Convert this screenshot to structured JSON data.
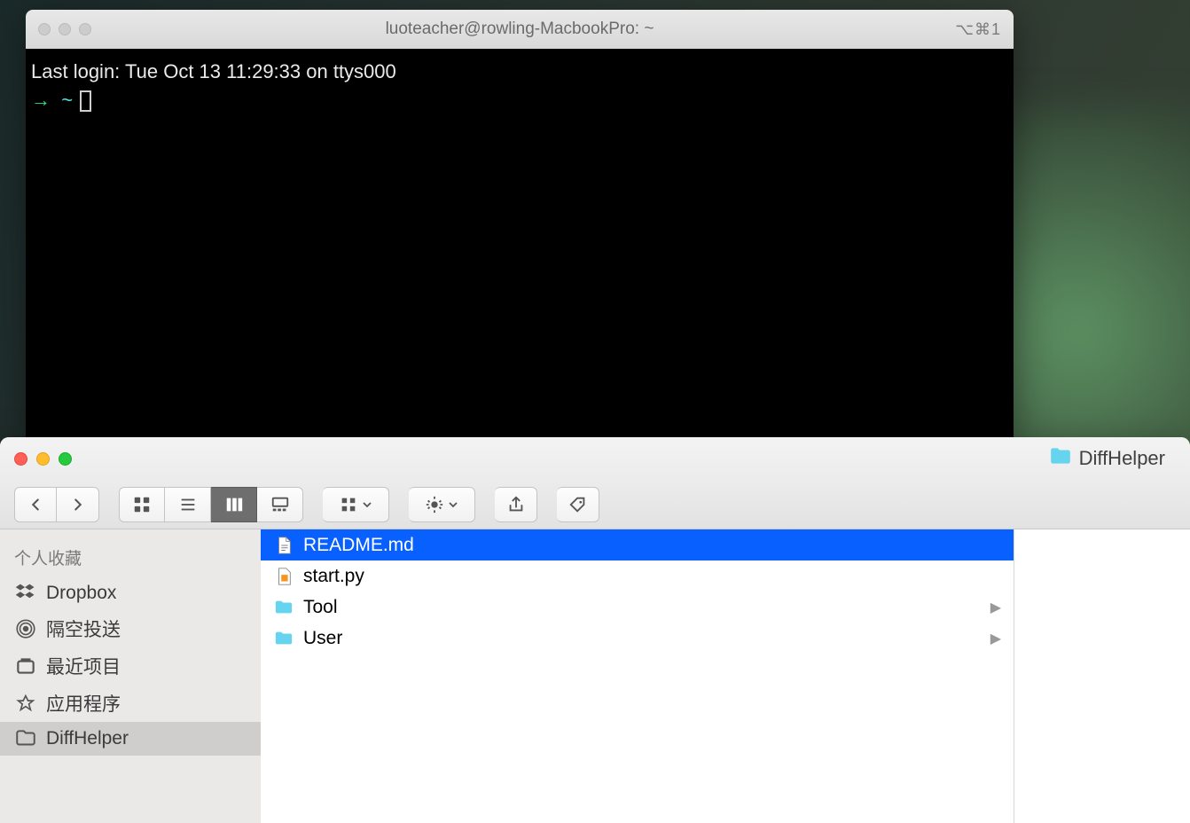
{
  "terminal": {
    "title": "luoteacher@rowling-MacbookPro: ~",
    "shortcut": "⌥⌘1",
    "last_login": "Last login: Tue Oct 13 11:29:33 on ttys000",
    "prompt_arrow": "→",
    "prompt_tilde": "~"
  },
  "finder": {
    "title": "DiffHelper",
    "sidebar": {
      "header": "个人收藏",
      "items": [
        {
          "label": "Dropbox",
          "icon": "dropbox"
        },
        {
          "label": "隔空投送",
          "icon": "airdrop"
        },
        {
          "label": "最近项目",
          "icon": "recents"
        },
        {
          "label": "应用程序",
          "icon": "applications"
        },
        {
          "label": "DiffHelper",
          "icon": "folder",
          "selected": true
        }
      ]
    },
    "column": [
      {
        "name": "README.md",
        "type": "document",
        "selected": true
      },
      {
        "name": "start.py",
        "type": "script"
      },
      {
        "name": "Tool",
        "type": "folder",
        "hasChildren": true
      },
      {
        "name": "User",
        "type": "folder",
        "hasChildren": true
      }
    ]
  }
}
